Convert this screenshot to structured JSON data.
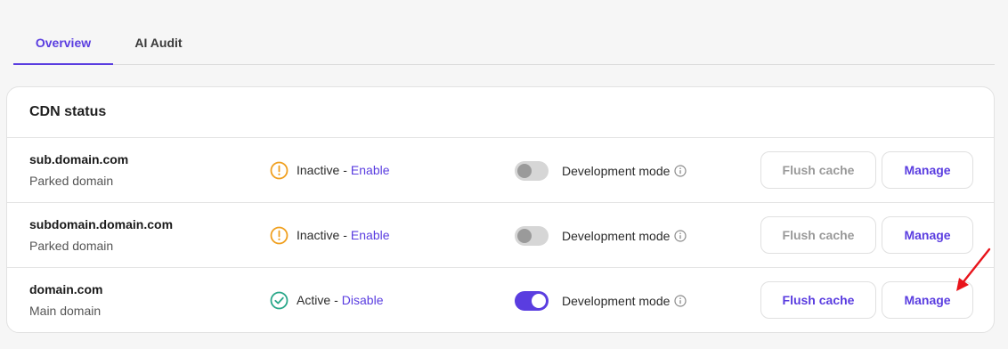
{
  "tabs": [
    {
      "label": "Overview"
    },
    {
      "label": "AI Audit"
    }
  ],
  "card": {
    "title": "CDN status",
    "rows": [
      {
        "domain": "sub.domain.com",
        "type": "Parked domain",
        "status": "Inactive",
        "separator": "-",
        "action": "Enable",
        "dev_mode_label": "Development mode",
        "dev_mode_on": false,
        "flush_label": "Flush cache",
        "manage_label": "Manage"
      },
      {
        "domain": "subdomain.domain.com",
        "type": "Parked domain",
        "status": "Inactive",
        "separator": "-",
        "action": "Enable",
        "dev_mode_label": "Development mode",
        "dev_mode_on": false,
        "flush_label": "Flush cache",
        "manage_label": "Manage"
      },
      {
        "domain": "domain.com",
        "type": "Main domain",
        "status": "Active",
        "separator": "-",
        "action": "Disable",
        "dev_mode_label": "Development mode",
        "dev_mode_on": true,
        "flush_label": "Flush cache",
        "manage_label": "Manage"
      }
    ]
  },
  "colors": {
    "accent": "#5a3de0",
    "warning": "#f0a020",
    "success": "#2aa88a",
    "annotation_arrow": "#e8141b"
  },
  "icons": {
    "inactive": "warning-circle-icon",
    "active": "check-circle-icon",
    "info": "info-icon",
    "annotation": "red-arrow-icon"
  }
}
